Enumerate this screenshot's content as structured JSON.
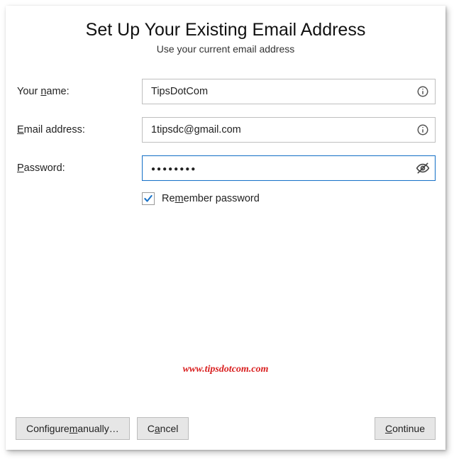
{
  "header": {
    "title": "Set Up Your Existing Email Address",
    "subtitle": "Use your current email address"
  },
  "form": {
    "name": {
      "label_pre": "Your ",
      "label_key": "n",
      "label_post": "ame:",
      "value": "TipsDotCom"
    },
    "email": {
      "label_key": "E",
      "label_post": "mail address:",
      "value": "1tipsdc@gmail.com"
    },
    "password": {
      "label_key": "P",
      "label_post": "assword:",
      "value_masked": "●●●●●●●●"
    },
    "remember": {
      "checked": true,
      "label_pre": "Re",
      "label_key": "m",
      "label_post": "ember password"
    }
  },
  "watermark": "www.tipsdotcom.com",
  "buttons": {
    "configure": {
      "pre": "Configure ",
      "key": "m",
      "post": "anually…"
    },
    "cancel": {
      "pre": "C",
      "key": "a",
      "post": "ncel"
    },
    "continue": {
      "pre": "",
      "key": "C",
      "post": "ontinue"
    }
  }
}
